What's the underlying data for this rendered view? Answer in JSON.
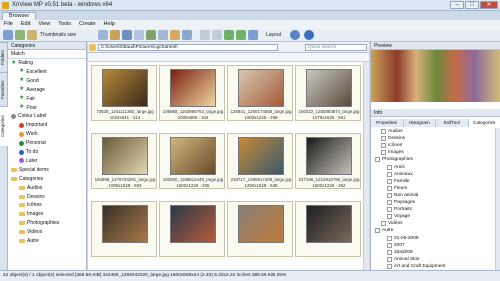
{
  "window": {
    "title": "XnView MP v0.51 beta - windows x64",
    "tab": "Browser"
  },
  "menu": [
    "File",
    "Edit",
    "View",
    "Tools",
    "Create",
    "Help"
  ],
  "toolbar": {
    "thumbnails": "Thumbnails size",
    "layout": "Layout"
  },
  "left_panel": {
    "title": "Categories",
    "match": "Match",
    "vtabs": [
      "Folders",
      "Favorites",
      "Categories"
    ],
    "tree": [
      {
        "label": "Rating",
        "kind": "star",
        "indent": 0
      },
      {
        "label": "Excellent",
        "kind": "star",
        "indent": 1
      },
      {
        "label": "Good",
        "kind": "star",
        "indent": 1
      },
      {
        "label": "Average",
        "kind": "star",
        "indent": 1
      },
      {
        "label": "Fair",
        "kind": "star",
        "indent": 1
      },
      {
        "label": "Poor",
        "kind": "star",
        "indent": 1
      },
      {
        "label": "Colour Label",
        "kind": "dot",
        "color": "#888888",
        "indent": 0
      },
      {
        "label": "Important",
        "kind": "dot",
        "color": "#d63a2e",
        "indent": 1
      },
      {
        "label": "Work",
        "kind": "dot",
        "color": "#e59a2a",
        "indent": 1
      },
      {
        "label": "Personal",
        "kind": "dot",
        "color": "#2d8c3a",
        "indent": 1
      },
      {
        "label": "To do",
        "kind": "dot",
        "color": "#2a5fc9",
        "indent": 1
      },
      {
        "label": "Later",
        "kind": "dot",
        "color": "#9a58c8",
        "indent": 1
      },
      {
        "label": "Special items",
        "kind": "fold",
        "indent": 0
      },
      {
        "label": "Categories",
        "kind": "fold",
        "indent": 0
      },
      {
        "label": "Audios",
        "kind": "fold",
        "indent": 1
      },
      {
        "label": "Dessins",
        "kind": "fold",
        "indent": 1
      },
      {
        "label": "Icônes",
        "kind": "fold",
        "indent": 1
      },
      {
        "label": "Images",
        "kind": "fold",
        "indent": 1
      },
      {
        "label": "Photographies",
        "kind": "fold",
        "indent": 1
      },
      {
        "label": "Vidéos",
        "kind": "fold",
        "indent": 1
      },
      {
        "label": "Autre",
        "kind": "fold",
        "indent": 1
      }
    ]
  },
  "center": {
    "path": "C:\\Users\\hbaud\\Pictures\\cgchannel\\",
    "search_placeholder": "Quick search",
    "thumbs": [
      {
        "name": "73638_1241111382_large.jpg",
        "info": "1024x541 - 314",
        "c1": "#b8893a",
        "c2": "#3a2a1a"
      },
      {
        "name": "106968_1163965763_large.jpg",
        "info": "1000x688 - 153",
        "c1": "#7a1f12",
        "c2": "#f0d7a0"
      },
      {
        "name": "125841_1250174558_large.jpg",
        "info": "1600x1226 - 268",
        "c1": "#d7c8b0",
        "c2": "#a45a38"
      },
      {
        "name": "160022_1205893874_large.jpg",
        "info": "1076x1626 - 551",
        "c1": "#c8c7c1",
        "c2": "#5a4a3c"
      },
      {
        "name": "192998_1279734291_large.jpg",
        "info": "1080x1628 - 693",
        "c1": "#6a5a3a",
        "c2": "#e2d6b0"
      },
      {
        "name": "193080_1188812449_large.jpg",
        "info": "1600x1226 - 205",
        "c1": "#d0b880",
        "c2": "#6a4a2a"
      },
      {
        "name": "218717_1250617408_large.jpg",
        "info": "1250x1628 - 638",
        "c1": "#c58a3a",
        "c2": "#3a5a6a"
      },
      {
        "name": "227196_1212816786_large.jpg",
        "info": "1600x1226 - 352",
        "c1": "#1a1a1a",
        "c2": "#c8c2b8"
      },
      {
        "name": "",
        "info": "",
        "c1": "#3a3028",
        "c2": "#a87a4a"
      },
      {
        "name": "",
        "info": "",
        "c1": "#2a3a4a",
        "c2": "#b85a3a"
      },
      {
        "name": "",
        "info": "",
        "c1": "#8a8078",
        "c2": "#c07a3a"
      },
      {
        "name": "",
        "info": "",
        "c1": "#1e1e22",
        "c2": "#7a6a5a"
      }
    ]
  },
  "right_panel": {
    "preview_title": "Preview",
    "info_title": "Info",
    "tabs": [
      "Properties",
      "Histogram",
      "ExifTool",
      "Categories"
    ],
    "categories": [
      {
        "label": "Audios",
        "indent": 1
      },
      {
        "label": "Dessins",
        "indent": 1
      },
      {
        "label": "Icônes",
        "indent": 1
      },
      {
        "label": "Images",
        "indent": 1
      },
      {
        "label": "Photographies",
        "indent": 0
      },
      {
        "label": "Amis",
        "indent": 2
      },
      {
        "label": "Animaux",
        "indent": 2
      },
      {
        "label": "Famille",
        "indent": 2
      },
      {
        "label": "Fleurs",
        "indent": 2
      },
      {
        "label": "Non animal",
        "indent": 2
      },
      {
        "label": "Paysages",
        "indent": 2
      },
      {
        "label": "Portraits",
        "indent": 2
      },
      {
        "label": "Voyage",
        "indent": 2
      },
      {
        "label": "Vidéos",
        "indent": 1
      },
      {
        "label": "Autre",
        "indent": 0
      },
      {
        "label": "01-09-2009",
        "indent": 2
      },
      {
        "label": "2007",
        "indent": 2
      },
      {
        "label": "3da2009",
        "indent": 2
      },
      {
        "label": "Animal Skin",
        "indent": 2
      },
      {
        "label": "Art and Craft Equipment",
        "indent": 2
      }
    ]
  },
  "status": "42 object(s) / 1 object(s) selected [386.56 KiB]   342459_1294042020_large.jpg   1600x666x24 (2.40)   5.33x2.22 inches   386.56 KiB   25%"
}
